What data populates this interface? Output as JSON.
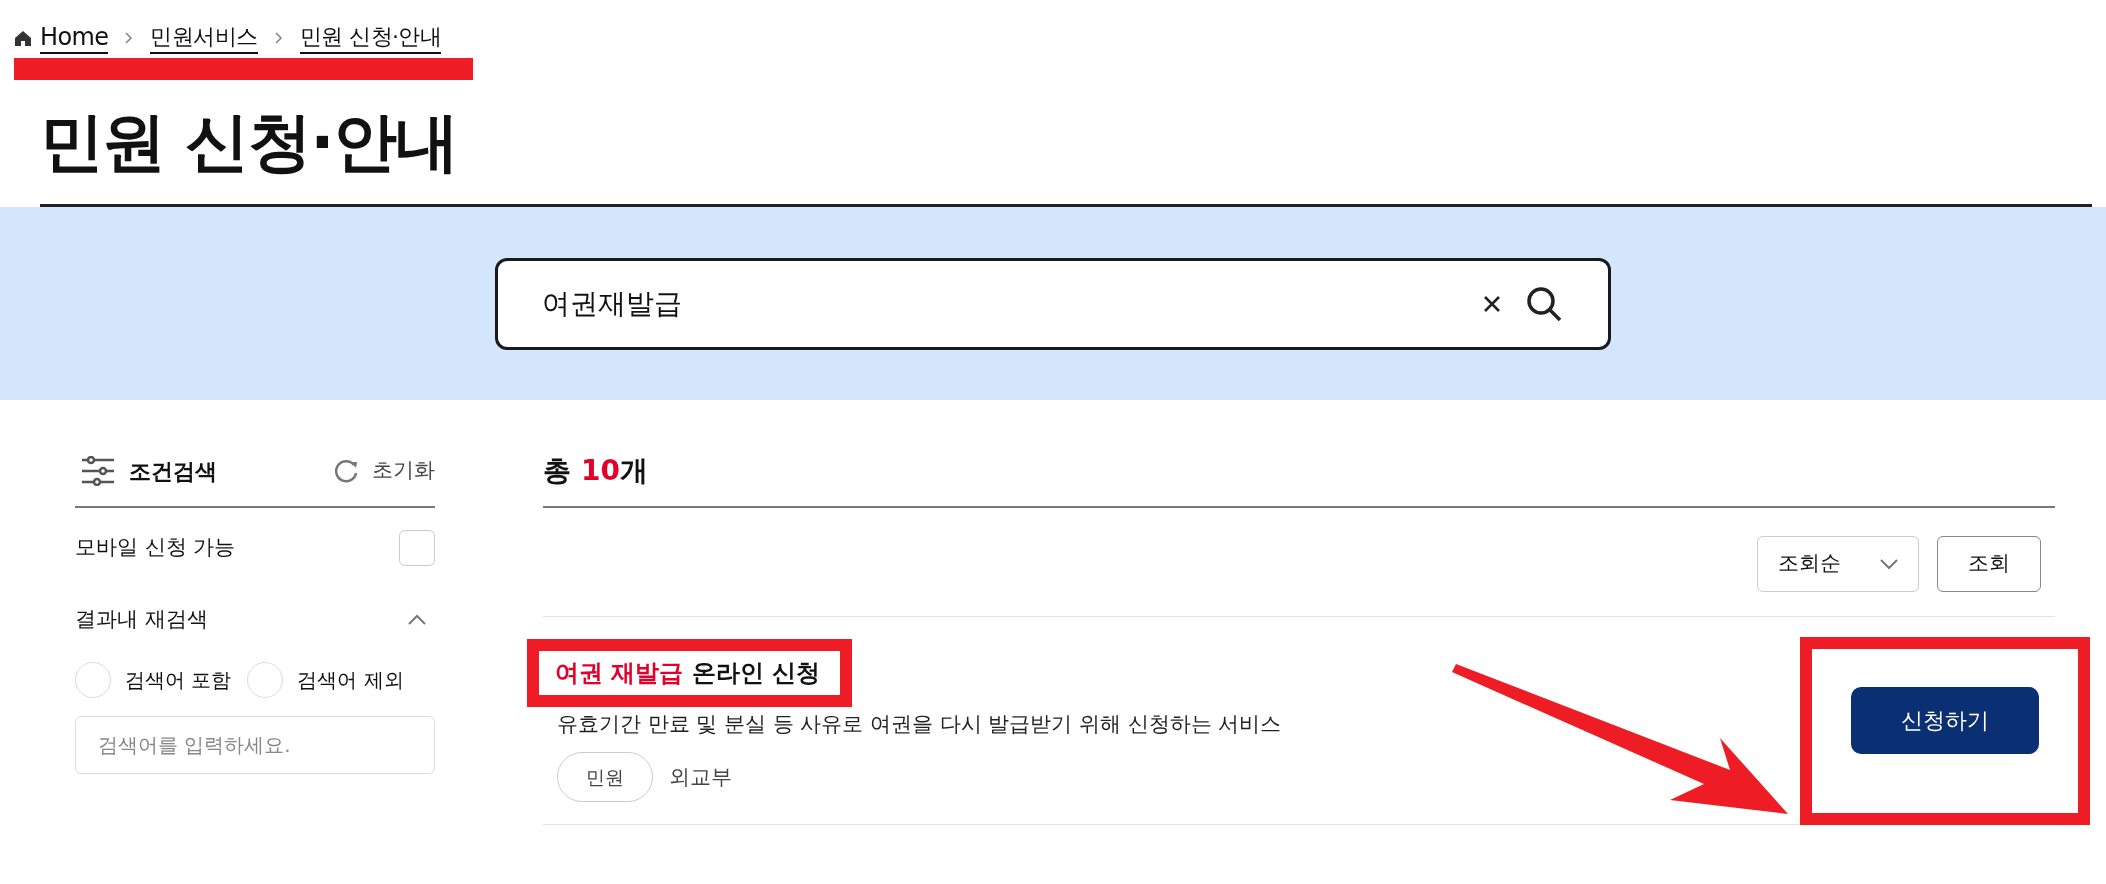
{
  "breadcrumb": [
    {
      "label": "Home",
      "kind": "home"
    },
    {
      "label": "민원서비스",
      "kind": "link"
    },
    {
      "label": "민원 신청·안내",
      "kind": "link"
    }
  ],
  "page_title": "민원 신청·안내",
  "search": {
    "value": "여권재발급"
  },
  "filter": {
    "title": "조건검색",
    "reset": "초기화",
    "mobile": {
      "label": "모바일 신청 가능",
      "checked": false
    },
    "research": {
      "label": "결과내 재검색",
      "expanded": true,
      "options": [
        {
          "label": "검색어 포함",
          "selected": false
        },
        {
          "label": "검색어 제외",
          "selected": false
        }
      ],
      "placeholder": "검색어를 입력하세요."
    }
  },
  "results": {
    "total_prefix": "총 ",
    "total_count": "10",
    "total_suffix": "개",
    "sort": "조회순",
    "sort_button": "조회",
    "items": [
      {
        "title_highlight": "여권 재발급",
        "title_rest": " 온라인 신청",
        "description": "유효기간 만료 및 분실 등 사유로 여권을 다시 발급받기 위해 신청하는 서비스",
        "tag": "민원",
        "agency": "외교부",
        "button": "신청하기"
      }
    ]
  }
}
